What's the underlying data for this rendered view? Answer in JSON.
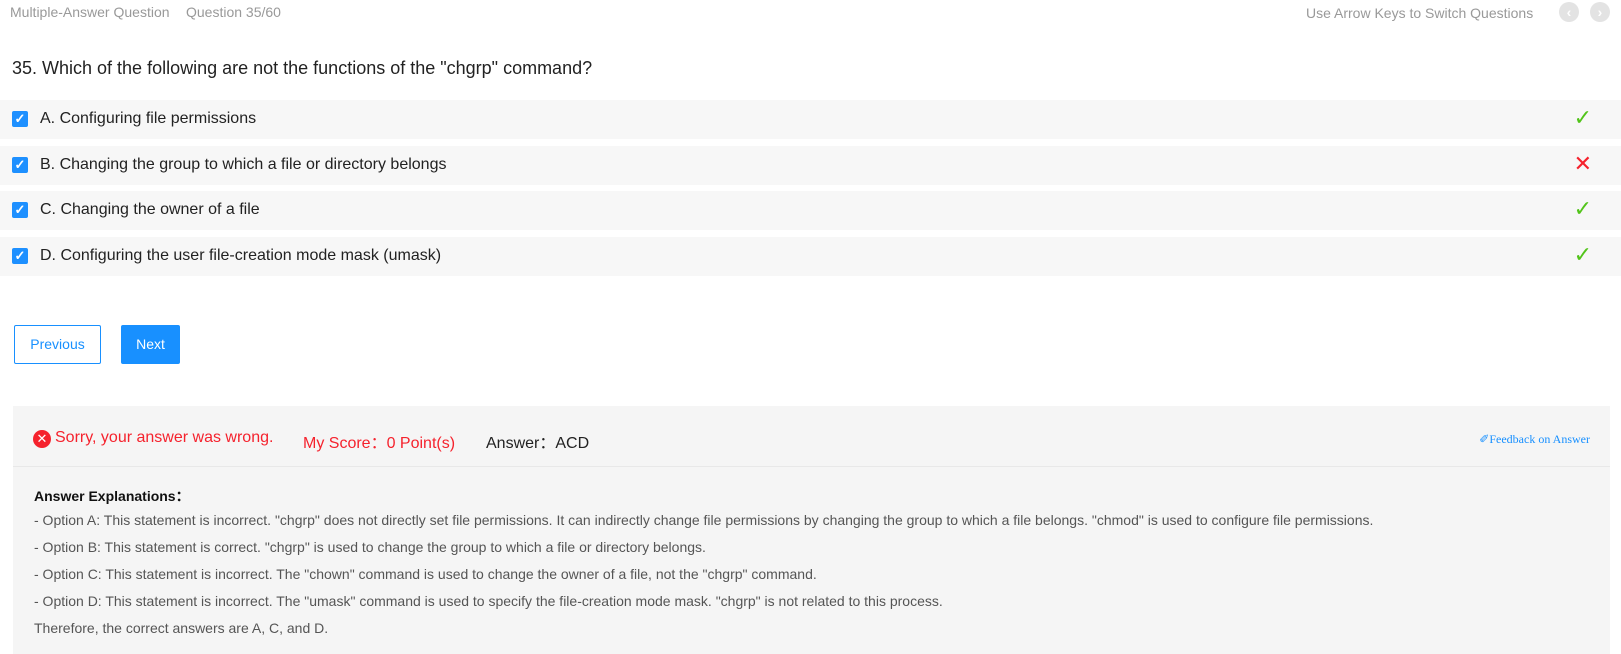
{
  "header": {
    "question_type": "Multiple-Answer Question",
    "question_counter": "Question 35/60",
    "keyboard_hint": "Use Arrow Keys to Switch Questions",
    "prev_icon": "chevron-left-icon",
    "next_icon": "chevron-right-icon"
  },
  "question": {
    "text": "35. Which of the following are not the functions of the \"chgrp\" command?"
  },
  "options": [
    {
      "label": "A. Configuring file permissions",
      "checked": true,
      "result": "correct",
      "mark": "✓"
    },
    {
      "label": "B. Changing the group to which a file or directory belongs",
      "checked": true,
      "result": "wrong",
      "mark": "✕"
    },
    {
      "label": "C. Changing the owner of a file",
      "checked": true,
      "result": "correct",
      "mark": "✓"
    },
    {
      "label": "D. Configuring the user file-creation mode mask (umask)",
      "checked": true,
      "result": "correct",
      "mark": "✓"
    }
  ],
  "buttons": {
    "previous": "Previous",
    "next": "Next"
  },
  "result": {
    "status_text": "Sorry, your answer was wrong.",
    "score_text": "My Score：0 Point(s)",
    "answer_text": "Answer：ACD",
    "feedback_link": "Feedback on Answer"
  },
  "explanation": {
    "title": "Answer Explanations：",
    "lines": [
      "- Option A: This statement is incorrect. \"chgrp\" does not directly set file permissions. It can indirectly change file permissions by changing the group to which a file belongs. \"chmod\" is used to configure file permissions.",
      "- Option B: This statement is correct. \"chgrp\" is used to change the group to which a file or directory belongs.",
      "- Option C: This statement is incorrect. The \"chown\" command is used to change the owner of a file, not the \"chgrp\" command.",
      "- Option D: This statement is incorrect. The \"umask\" command is used to specify the file-creation mode mask. \"chgrp\" is not related to this process.",
      "Therefore, the correct answers are A, C, and D."
    ]
  },
  "colors": {
    "accent": "#1890ff",
    "correct": "#52c41a",
    "wrong": "#f5222d"
  }
}
